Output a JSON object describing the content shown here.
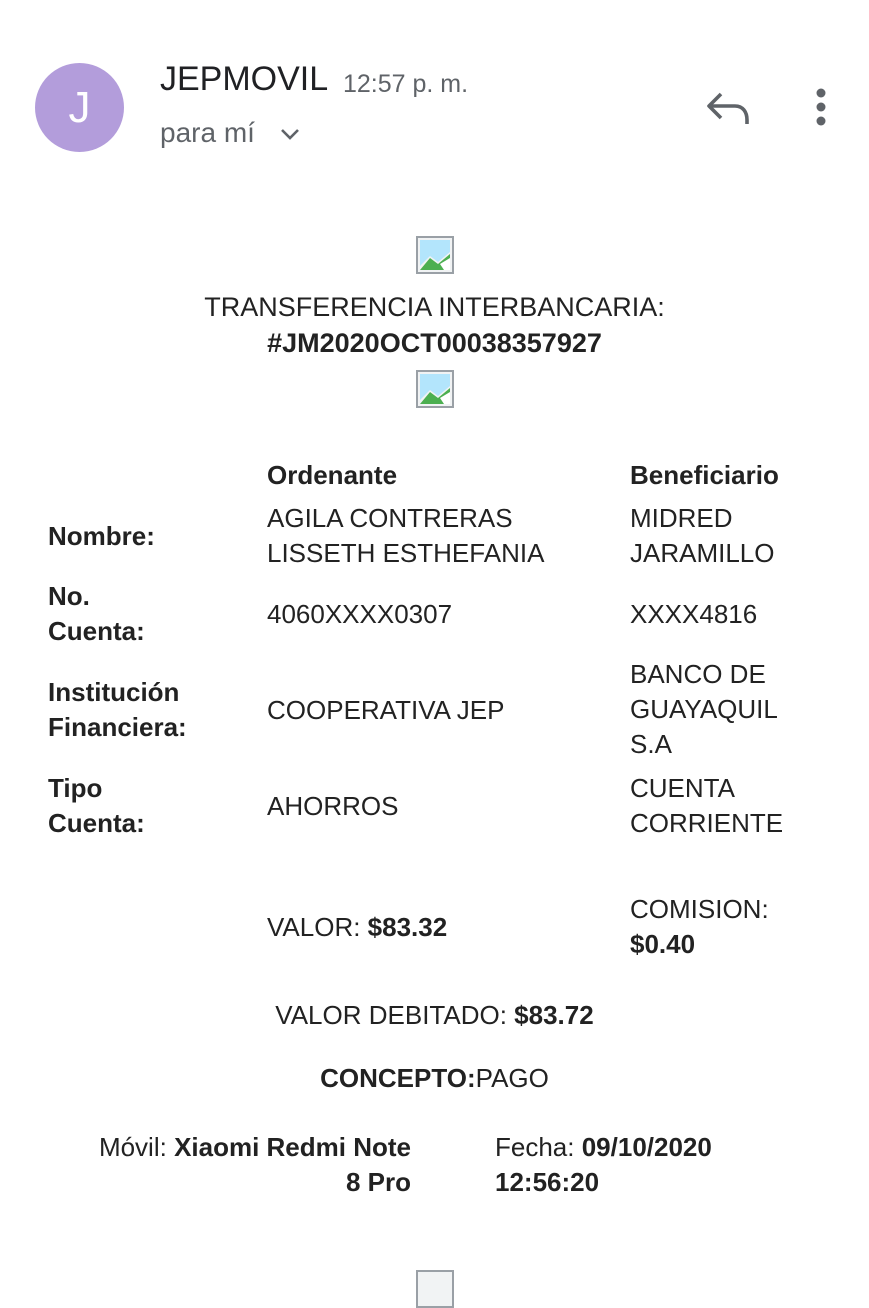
{
  "header": {
    "avatar_letter": "J",
    "avatar_color": "#b39ddb",
    "sender": "JEPMOVIL",
    "time": "12:57 p. m.",
    "recipient": "para mí"
  },
  "email": {
    "title": "TRANSFERENCIA INTERBANCARIA:",
    "transaction_id": "#JM2020OCT00038357927",
    "columns": {
      "ordering": "Ordenante",
      "beneficiary": "Beneficiario"
    },
    "rows": {
      "nombre": {
        "label": "Nombre:",
        "ordering": "AGILA CONTRERAS\nLISSETH ESTHEFANIA",
        "beneficiary": "MIDRED\nJARAMILLO"
      },
      "cuenta": {
        "label": "No.\nCuenta:",
        "ordering": "4060XXXX0307",
        "beneficiary": "XXXX4816"
      },
      "institucion": {
        "label": "Institución\nFinanciera:",
        "ordering": "COOPERATIVA JEP",
        "beneficiary": "BANCO DE\nGUAYAQUIL\nS.A"
      },
      "tipo": {
        "label": "Tipo\nCuenta:",
        "ordering": "AHORROS",
        "beneficiary": "CUENTA\nCORRIENTE"
      }
    },
    "valor": {
      "label": "VALOR: ",
      "amount": "$83.32"
    },
    "comision": {
      "label": "COMISION:",
      "amount": "$0.40"
    },
    "debitado": {
      "label": "VALOR DEBITADO: ",
      "amount": "$83.72"
    },
    "concepto": {
      "label": "CONCEPTO:",
      "value": "PAGO"
    },
    "movil": {
      "label": "Móvil: ",
      "value_line1": "Xiaomi Redmi Note",
      "value_line2": "8 Pro"
    },
    "fecha": {
      "label": "Fecha: ",
      "date": "09/10/2020",
      "time": "12:56:20"
    }
  }
}
